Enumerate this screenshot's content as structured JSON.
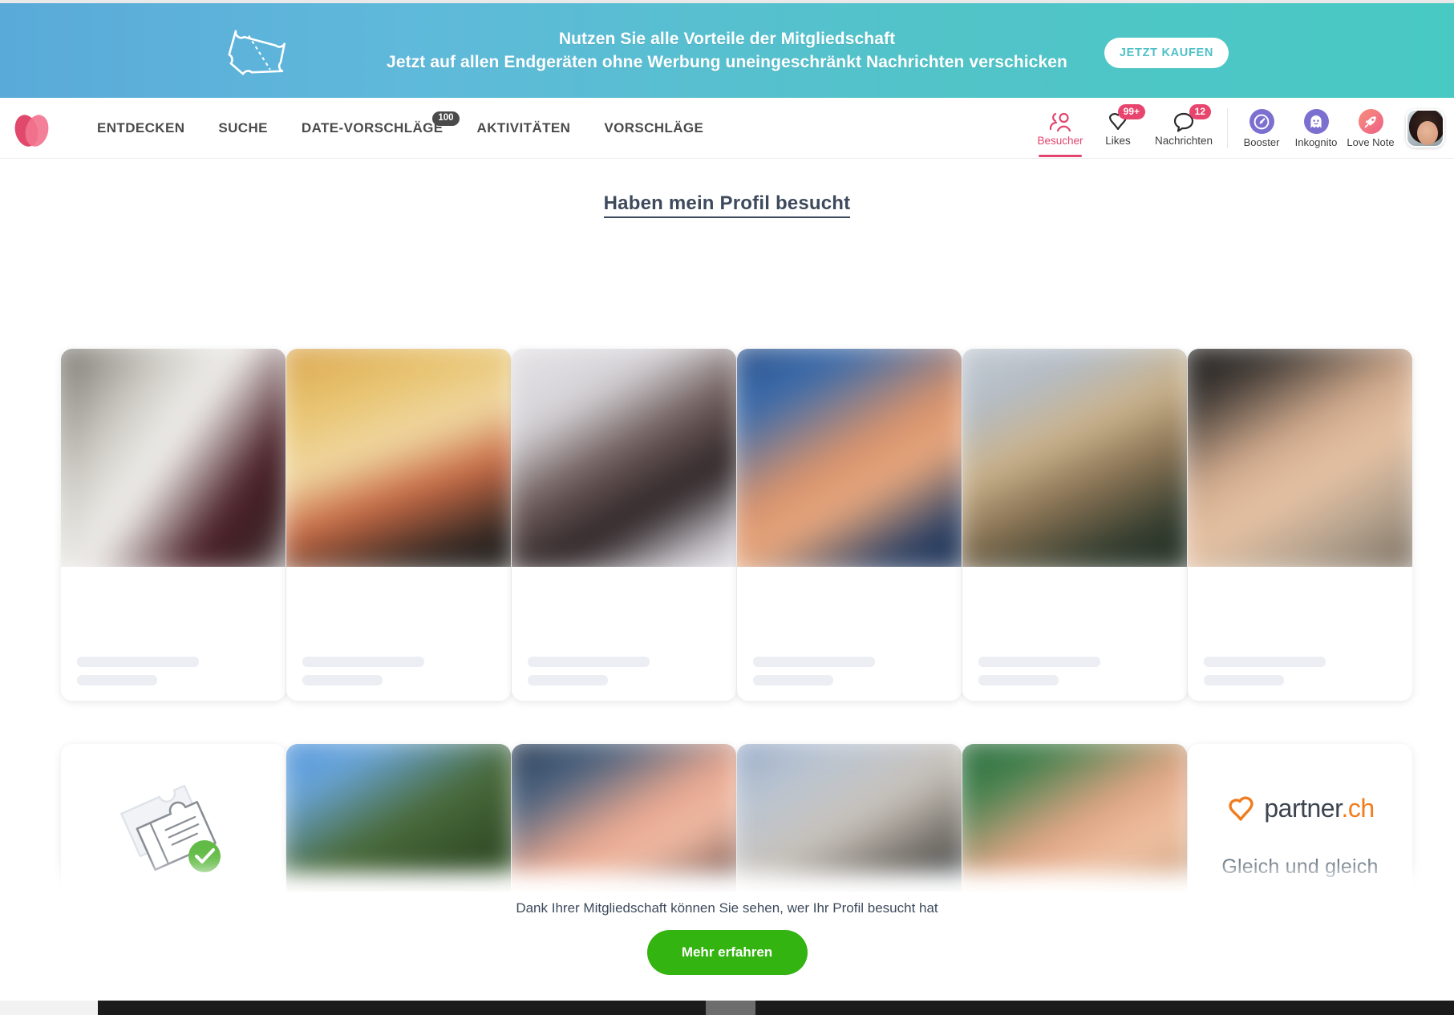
{
  "promo": {
    "icon": "ticket-icon",
    "line1": "Nutzen Sie alle Vorteile der Mitgliedschaft",
    "line2": "Jetzt auf allen Endgeräten ohne Werbung uneingeschränkt Nachrichten verschicken",
    "cta": "JETZT KAUFEN",
    "gradient_from": "#5aaad9",
    "gradient_to": "#48c9c3"
  },
  "nav": {
    "logo": "partner-heart-logo",
    "items": [
      {
        "label": "ENTDECKEN",
        "badge": null
      },
      {
        "label": "SUCHE",
        "badge": null
      },
      {
        "label": "DATE-VORSCHLÄGE",
        "badge": "100"
      },
      {
        "label": "AKTIVITÄTEN",
        "badge": null
      },
      {
        "label": "VORSCHLÄGE",
        "badge": null
      }
    ],
    "counters": [
      {
        "label": "Besucher",
        "icon": "visitors-icon",
        "badge": null,
        "active": true
      },
      {
        "label": "Likes",
        "icon": "heart-pin-icon",
        "badge": "99+",
        "active": false
      },
      {
        "label": "Nachrichten",
        "icon": "speech-bubble-icon",
        "badge": "12",
        "active": false
      }
    ],
    "features": [
      {
        "label": "Booster",
        "icon": "speedometer-icon",
        "color": "#7b6fd0"
      },
      {
        "label": "Inkognito",
        "icon": "ghost-icon",
        "color": "#7b6fd0"
      },
      {
        "label": "Love Note",
        "icon": "rocket-icon",
        "color": "#f2708a"
      }
    ],
    "avatar": "user-avatar",
    "accent": "#e0466e"
  },
  "page": {
    "title": "Haben mein Profil besucht"
  },
  "cards": {
    "row1": [
      {
        "name": "visitor-card-1",
        "photo_css": "linear-gradient(125deg,#6d6a62 0%,#cfcdc6 30%,#f2f1ee 48%,#4b2128 72%,#3a1f22 86%,#b9bdbd 100%)"
      },
      {
        "name": "visitor-card-2",
        "photo_css": "linear-gradient(160deg,#d8a24c 0%,#e8c36f 25%,#f0d9a3 45%,#c96a44 62%,#2c2522 85%,#1d1a18 100%)"
      },
      {
        "name": "visitor-card-3",
        "photo_css": "linear-gradient(150deg,#e8e6e8 0%,#d4d2d6 28%,#6e5c5a 48%,#2b2224 68%,#cfccd2 88%,#e9e7ea 100%)"
      },
      {
        "name": "visitor-card-4",
        "photo_css": "linear-gradient(150deg,#2b4f86 0%,#3a6bab 22%,#d7926c 48%,#e8a87e 62%,#2a3f63 84%,#1e3050 100%)"
      },
      {
        "name": "visitor-card-5",
        "photo_css": "linear-gradient(155deg,#c6cdd4 0%,#b3bcc6 22%,#cbb38c 42%,#8a7354 60%,#2f3a2d 82%,#1f2a1e 100%)"
      },
      {
        "name": "visitor-card-6",
        "photo_css": "linear-gradient(150deg,#1d1b1a 0%,#3c3733 18%,#cfa98c 42%,#e7c3a4 58%,#b2a08c 78%,#6f6356 100%)"
      }
    ],
    "row2": [
      {
        "name": "membership-ticket-card",
        "type": "ticket",
        "icon": "ticket-check-icon"
      },
      {
        "name": "visitor-card-7",
        "photo_css": "linear-gradient(150deg,#4a90d9 0%,#6aa6dd 18%,#4a6b3a 42%,#2f4a26 65%,#567a3c 85%,#3d5c2b 100%)"
      },
      {
        "name": "visitor-card-8",
        "photo_css": "linear-gradient(150deg,#2c3a4e 0%,#47607e 20%,#e9a890 42%,#f0bba4 55%,#5a3d3a 80%,#232b3a 100%)"
      },
      {
        "name": "visitor-card-9",
        "photo_css": "linear-gradient(150deg,#8fa3c4 0%,#b9c4d2 20%,#c9c3bb 42%,#6f6a63 62%,#3d4a57 82%,#9aa6b4 100%)"
      },
      {
        "name": "visitor-card-10",
        "photo_css": "linear-gradient(150deg,#2f6b3e 0%,#3d7f4b 18%,#e0a585 42%,#f0c2a3 58%,#c99a78 78%,#8a6a50 100%)"
      },
      {
        "name": "brand-card",
        "type": "brand",
        "brand": "partner",
        "brand_suffix": ".ch",
        "tagline": "Gleich und gleich"
      }
    ]
  },
  "bottom": {
    "message": "Dank Ihrer Mitgliedschaft können Sie sehen, wer Ihr Profil besucht hat",
    "button": "Mehr erfahren",
    "button_color": "#34b410"
  }
}
